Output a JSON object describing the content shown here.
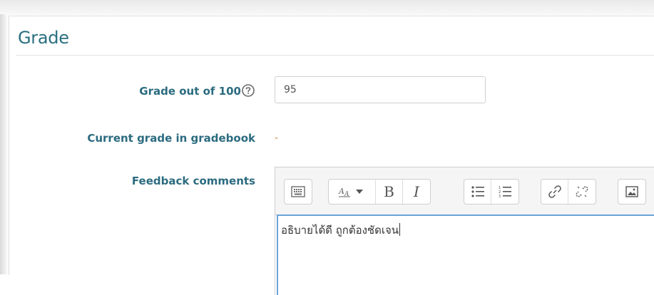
{
  "section": {
    "title": "Grade"
  },
  "grade": {
    "label": "Grade out of 100",
    "value": "95",
    "help_icon": "question-circle-icon"
  },
  "current": {
    "label": "Current grade in gradebook",
    "value": "-"
  },
  "feedback": {
    "label": "Feedback comments",
    "text": "อธิบายได้ดี ถูกต้องชัดเจน",
    "toolbar": [
      {
        "group": "toggle",
        "buttons": [
          "show-more-buttons-icon"
        ]
      },
      {
        "group": "style",
        "buttons": [
          "paragraph-styles-icon",
          "bold-icon",
          "italic-icon"
        ],
        "bold_glyph": "B",
        "italic_glyph": "I"
      },
      {
        "group": "list",
        "buttons": [
          "unordered-list-icon",
          "ordered-list-icon"
        ]
      },
      {
        "group": "links",
        "buttons": [
          "link-icon",
          "unlink-icon"
        ]
      },
      {
        "group": "media",
        "buttons": [
          "image-icon"
        ]
      }
    ]
  },
  "colors": {
    "label": "#2b6b7f",
    "title": "#2a6f80",
    "focus_border": "#6aa4d8",
    "dash": "#c9893a"
  }
}
